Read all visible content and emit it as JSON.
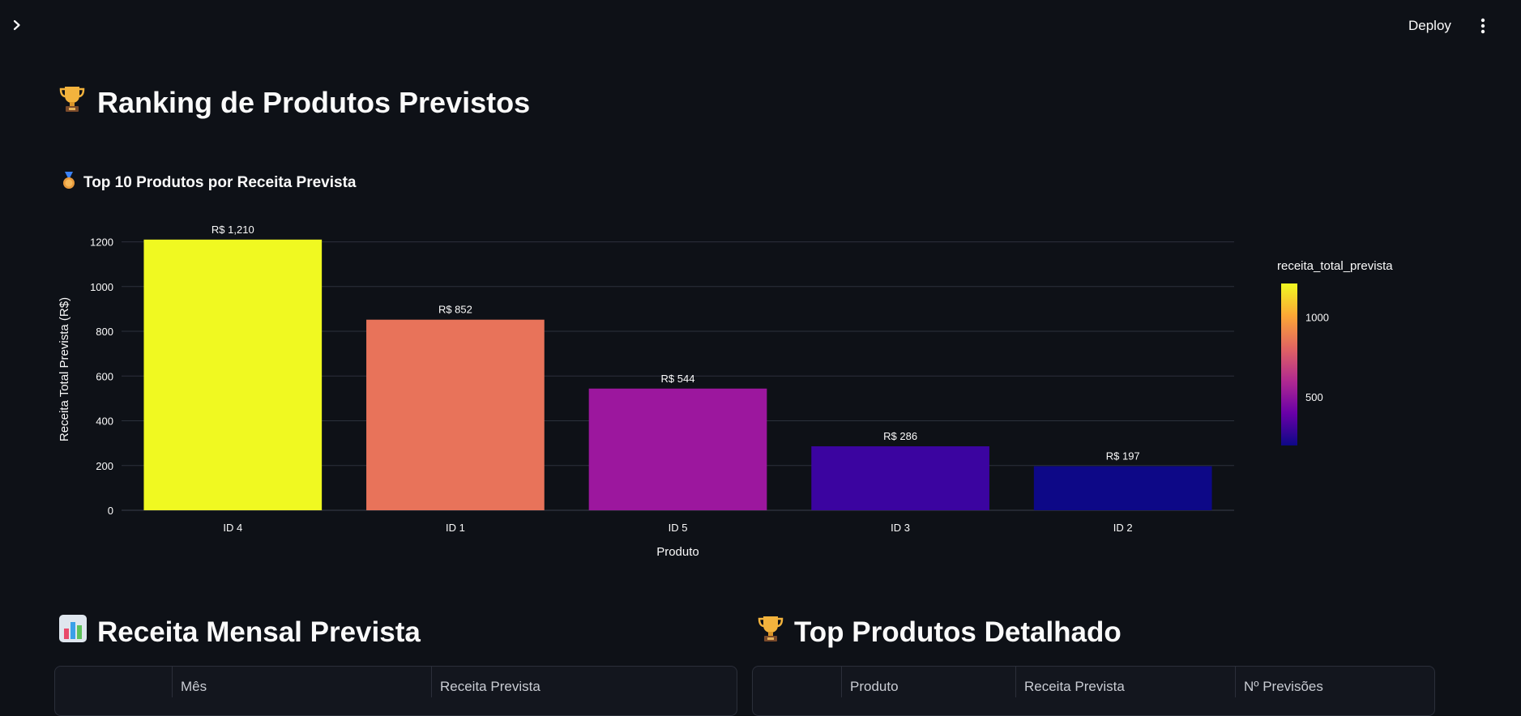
{
  "header": {
    "deploy_label": "Deploy"
  },
  "page": {
    "title": "Ranking de Produtos Previstos",
    "subtitle": "Top 10 Produtos por Receita Prevista"
  },
  "chart_data": {
    "type": "bar",
    "categories": [
      "ID 4",
      "ID 1",
      "ID 5",
      "ID 3",
      "ID 2"
    ],
    "values": [
      1210,
      852,
      544,
      286,
      197
    ],
    "data_labels": [
      "R$ 1,210",
      "R$ 852",
      "R$ 544",
      "R$ 286",
      "R$ 197"
    ],
    "colors": [
      "#f0f921",
      "#e8735a",
      "#9c179e",
      "#3b04a0",
      "#0d0887"
    ],
    "xlabel": "Produto",
    "ylabel": "Receita Total Prevista (R$)",
    "ylim": [
      0,
      1260
    ],
    "yticks": [
      0,
      200,
      400,
      600,
      800,
      1000,
      1200
    ],
    "grid": true,
    "colorbar": {
      "title": "receita_total_prevista",
      "ticks": [
        500,
        1000
      ],
      "range": [
        197,
        1210
      ],
      "colorscale": [
        "#0d0887",
        "#6a00a8",
        "#b12a90",
        "#e16462",
        "#fca636",
        "#f0f921"
      ]
    }
  },
  "monthly": {
    "title": "Receita Mensal Prevista",
    "columns": [
      "",
      "Mês",
      "Receita Prevista"
    ]
  },
  "top_products": {
    "title": "Top Produtos Detalhado",
    "columns": [
      "",
      "Produto",
      "Receita Prevista",
      "Nº Previsões"
    ]
  }
}
